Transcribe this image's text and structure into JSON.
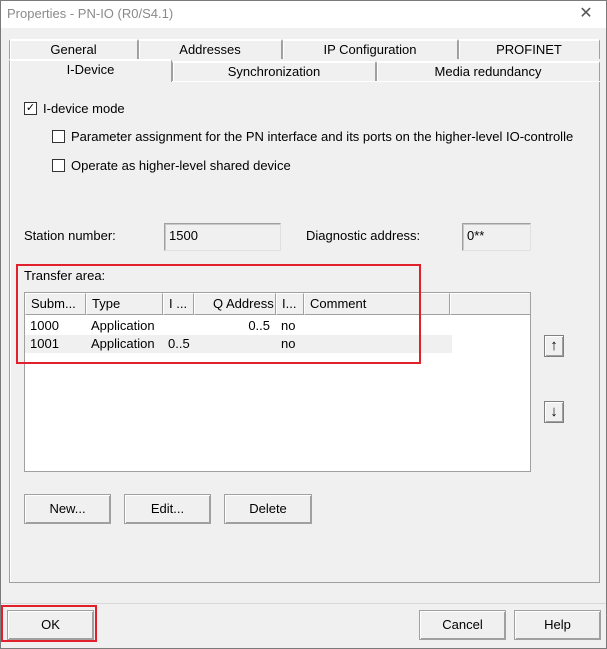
{
  "window": {
    "title": "Properties - PN-IO (R0/S4.1)",
    "close_glyph": "✕"
  },
  "tabs": {
    "row1": [
      {
        "label": "General"
      },
      {
        "label": "Addresses"
      },
      {
        "label": "IP Configuration"
      },
      {
        "label": "PROFINET"
      }
    ],
    "row2": [
      {
        "label": "I-Device",
        "active": true
      },
      {
        "label": "Synchronization"
      },
      {
        "label": "Media redundancy"
      }
    ]
  },
  "idevice": {
    "mode_label": "I-device mode",
    "mode_checked": true,
    "param_label": "Parameter assignment for the PN interface and its ports on the higher-level IO-controlle",
    "param_checked": false,
    "shared_label": "Operate as higher-level shared device",
    "shared_checked": false
  },
  "station": {
    "label": "Station number:",
    "value": "1500"
  },
  "diagnostic": {
    "label": "Diagnostic address:",
    "value": "0**"
  },
  "transfer_area": {
    "label": "Transfer area:",
    "columns": [
      "Subm...",
      "Type",
      "I ...",
      "Q Address",
      "I...",
      "Comment"
    ],
    "rows": [
      {
        "submodule": "1000",
        "type": "Application",
        "i_address": "",
        "q_address": "0..5",
        "i_flag": "no",
        "comment": ""
      },
      {
        "submodule": "1001",
        "type": "Application",
        "i_address": "0..5",
        "q_address": "",
        "i_flag": "no",
        "comment": ""
      }
    ],
    "up_glyph": "↑",
    "down_glyph": "↓"
  },
  "actions": {
    "new_label": "New...",
    "edit_label": "Edit...",
    "delete_label": "Delete"
  },
  "footer": {
    "ok_label": "OK",
    "cancel_label": "Cancel",
    "help_label": "Help"
  },
  "colors": {
    "highlight": "#e0202a",
    "window_bg": "#f0f0f0"
  }
}
